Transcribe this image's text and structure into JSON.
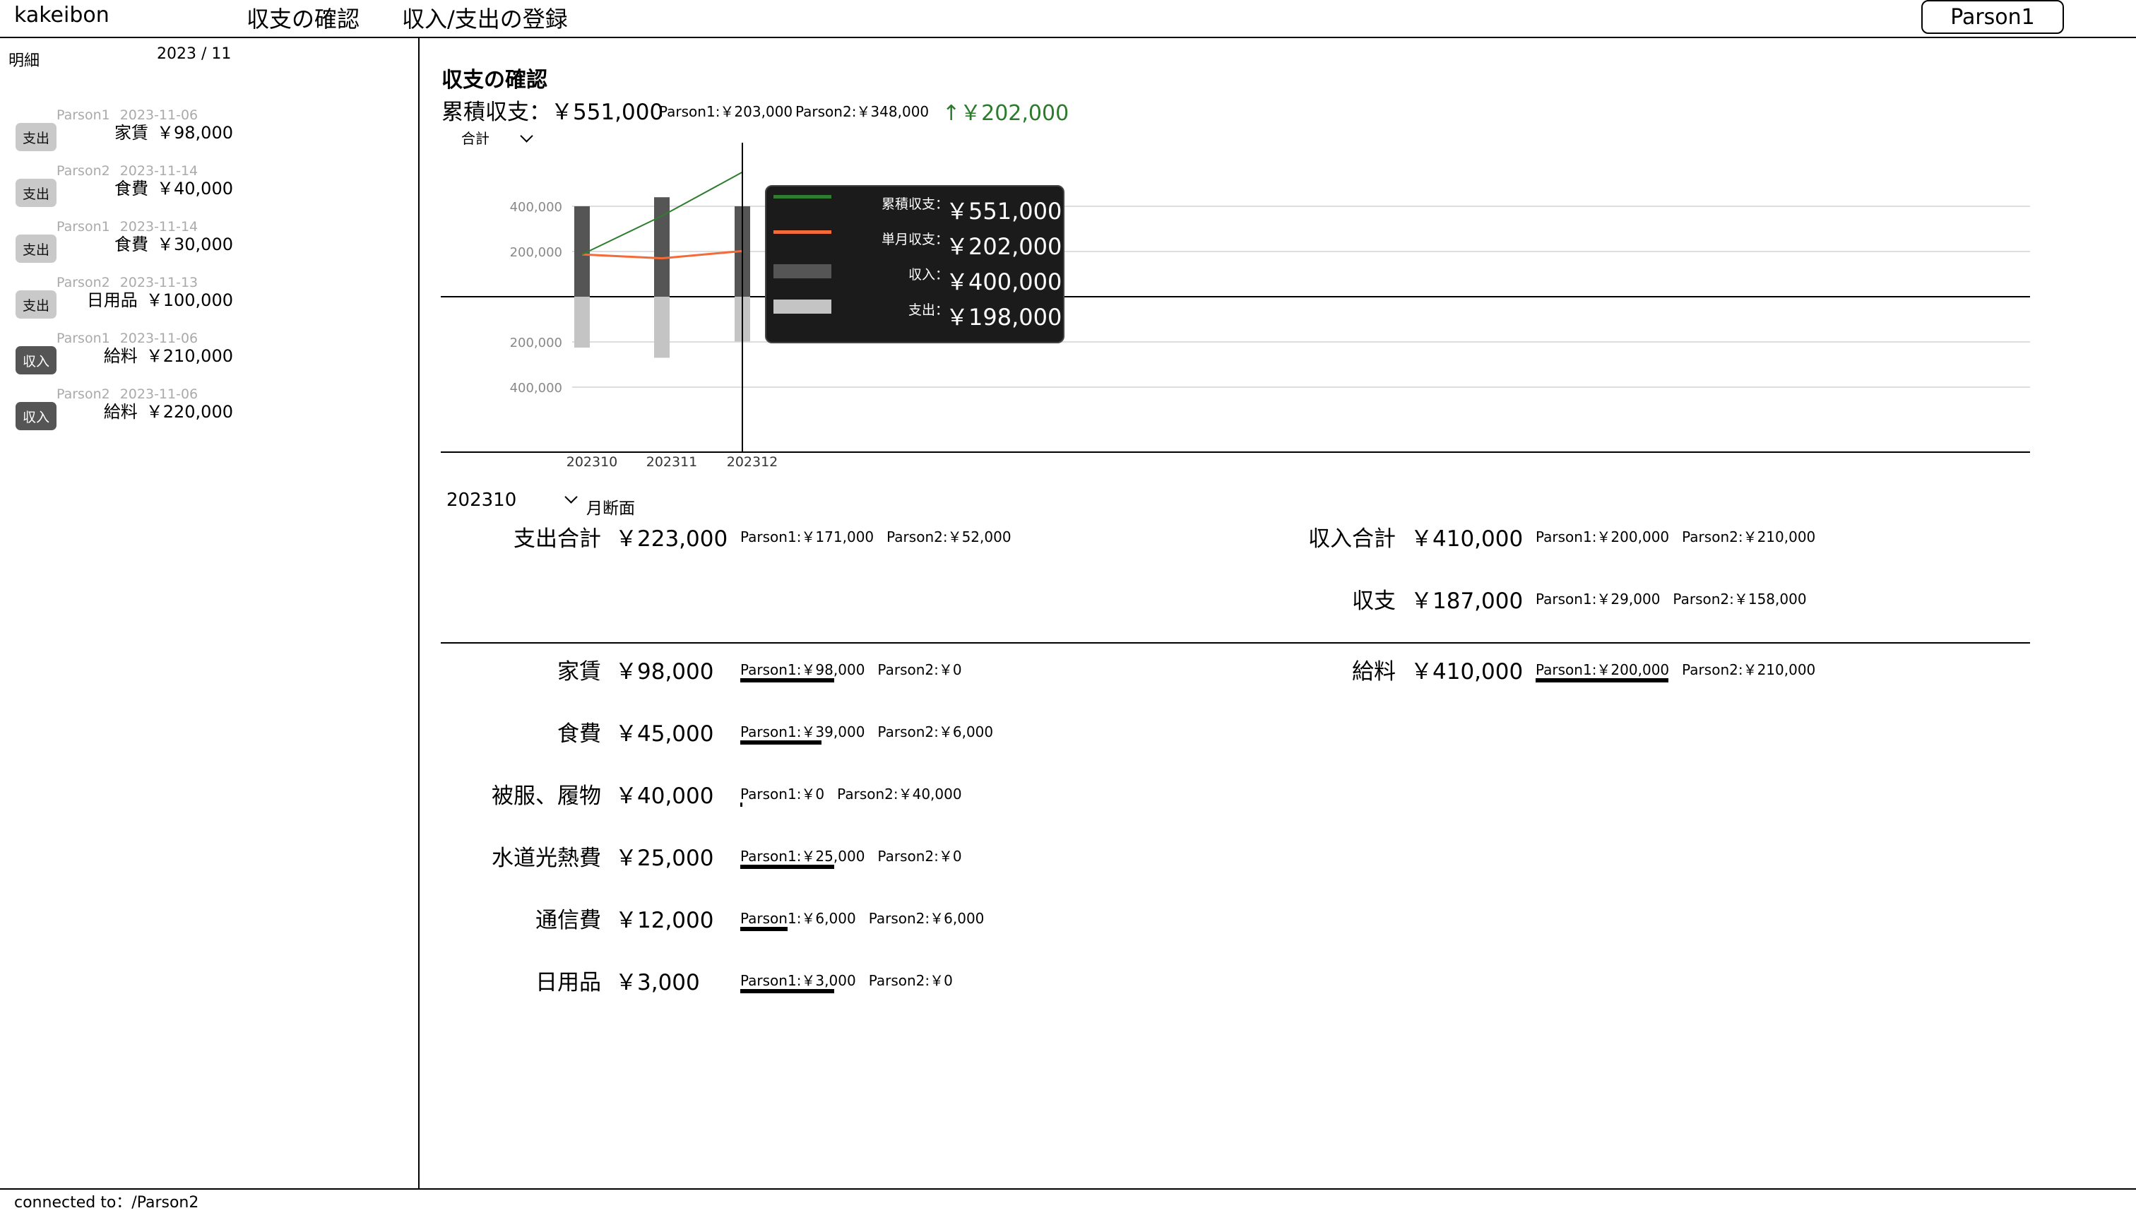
{
  "header": {
    "app_title": "kakeibon",
    "nav": [
      "収支の確認",
      "収入/支出の登録"
    ],
    "user_button": "Parson1"
  },
  "sidebar": {
    "title": "明細",
    "date": "2023 / 11",
    "items": [
      {
        "person": "Parson1",
        "date": "2023-11-06",
        "type": "支出",
        "kind": "expense",
        "category": "家賃",
        "amount": "￥98,000"
      },
      {
        "person": "Parson2",
        "date": "2023-11-14",
        "type": "支出",
        "kind": "expense",
        "category": "食費",
        "amount": "￥40,000"
      },
      {
        "person": "Parson1",
        "date": "2023-11-14",
        "type": "支出",
        "kind": "expense",
        "category": "食費",
        "amount": "￥30,000"
      },
      {
        "person": "Parson2",
        "date": "2023-11-13",
        "type": "支出",
        "kind": "expense",
        "category": "日用品",
        "amount": "￥100,000"
      },
      {
        "person": "Parson1",
        "date": "2023-11-06",
        "type": "収入",
        "kind": "income",
        "category": "給料",
        "amount": "￥210,000"
      },
      {
        "person": "Parson2",
        "date": "2023-11-06",
        "type": "収入",
        "kind": "income",
        "category": "給料",
        "amount": "￥220,000"
      }
    ]
  },
  "main": {
    "title": "収支の確認",
    "cumulative_label": "累積収支：￥551,000",
    "cumulative_p1": "Parson1:￥203,000",
    "cumulative_p2": "Parson2:￥348,000",
    "cumulative_change": "↑￥202,000",
    "view_select": "合計"
  },
  "tooltip": {
    "rows": [
      {
        "label": "累積収支：",
        "value": "￥551,000"
      },
      {
        "label": "単月収支：",
        "value": "￥202,000"
      },
      {
        "label": "収入：",
        "value": "￥400,000"
      },
      {
        "label": "支出：",
        "value": "￥198,000"
      }
    ]
  },
  "chart_data": {
    "type": "bar",
    "categories": [
      "202310",
      "202311",
      "202312"
    ],
    "series": [
      {
        "values": [
          400000,
          440000,
          400000
        ]
      },
      {
        "values": [
          225000,
          270000,
          198000
        ]
      },
      {
        "values": [
          187000,
          170000,
          202000
        ]
      },
      {
        "values": [
          187000,
          357000,
          551000
        ]
      }
    ],
    "y_ticks_above": [
      "400,000",
      "200,000"
    ],
    "y_ticks_below": [
      "200,000",
      "400,000"
    ],
    "ylim": [
      -600000,
      700000
    ],
    "grid": true,
    "hover_category": "202312",
    "colors": {
      "income": "#555555",
      "expense": "#c4c4c4",
      "monthly": "#f26b38",
      "cumulative": "#2f7d2f"
    }
  },
  "month": {
    "selected": "202310",
    "caption": "月断面",
    "expense_total": {
      "label": "支出合計",
      "value": "￥223,000",
      "p1": "Parson1:￥171,000",
      "p2": "Parson2:￥52,000"
    },
    "income_total": {
      "label": "収入合計",
      "value": "￥410,000",
      "p1": "Parson1:￥200,000",
      "p2": "Parson2:￥210,000"
    },
    "balance": {
      "label": "収支",
      "value": "￥187,000",
      "p1": "Parson1:￥29,000",
      "p2": "Parson2:￥158,000"
    },
    "expense_categories": [
      {
        "label": "家賃",
        "value": "￥98,000",
        "p1": "Parson1:￥98,000",
        "p2": "Parson2:￥0",
        "share": 1.0
      },
      {
        "label": "食費",
        "value": "￥45,000",
        "p1": "Parson1:￥39,000",
        "p2": "Parson2:￥6,000",
        "share": 0.867
      },
      {
        "label": "被服、履物",
        "value": "￥40,000",
        "p1": "Parson1:￥0",
        "p2": "Parson2:￥40,000",
        "share": 0.0
      },
      {
        "label": "水道光熱費",
        "value": "￥25,000",
        "p1": "Parson1:￥25,000",
        "p2": "Parson2:￥0",
        "share": 1.0
      },
      {
        "label": "通信費",
        "value": "￥12,000",
        "p1": "Parson1:￥6,000",
        "p2": "Parson2:￥6,000",
        "share": 0.5
      },
      {
        "label": "日用品",
        "value": "￥3,000",
        "p1": "Parson1:￥3,000",
        "p2": "Parson2:￥0",
        "share": 1.0
      }
    ],
    "income_categories": [
      {
        "label": "給料",
        "value": "￥410,000",
        "p1": "Parson1:￥200,000",
        "p2": "Parson2:￥210,000",
        "share": 0.488
      }
    ]
  },
  "footer": {
    "status": "connected to：/Parson2"
  }
}
